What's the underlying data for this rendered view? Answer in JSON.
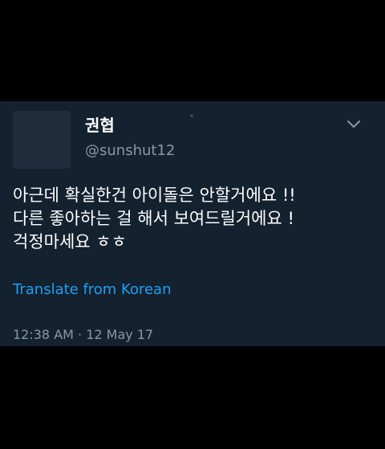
{
  "tweet": {
    "display_name": "권협",
    "handle": "@sunshut12",
    "text": "아근데 확실한건 아이돌은 안할거에요 !!\n다른 좋아하는 걸 해서 보여드릴거에요 !\n걱정마세요 ㅎㅎ",
    "translate_label": "Translate from Korean",
    "timestamp": "12:38 AM · 12 May 17"
  },
  "icons": {
    "menu": "chevron-down-icon"
  },
  "colors": {
    "page_background": "#000000",
    "card_background": "#14212f",
    "primary_text": "#ffffff",
    "secondary_text": "#8899a6",
    "link": "#1da1f2"
  }
}
